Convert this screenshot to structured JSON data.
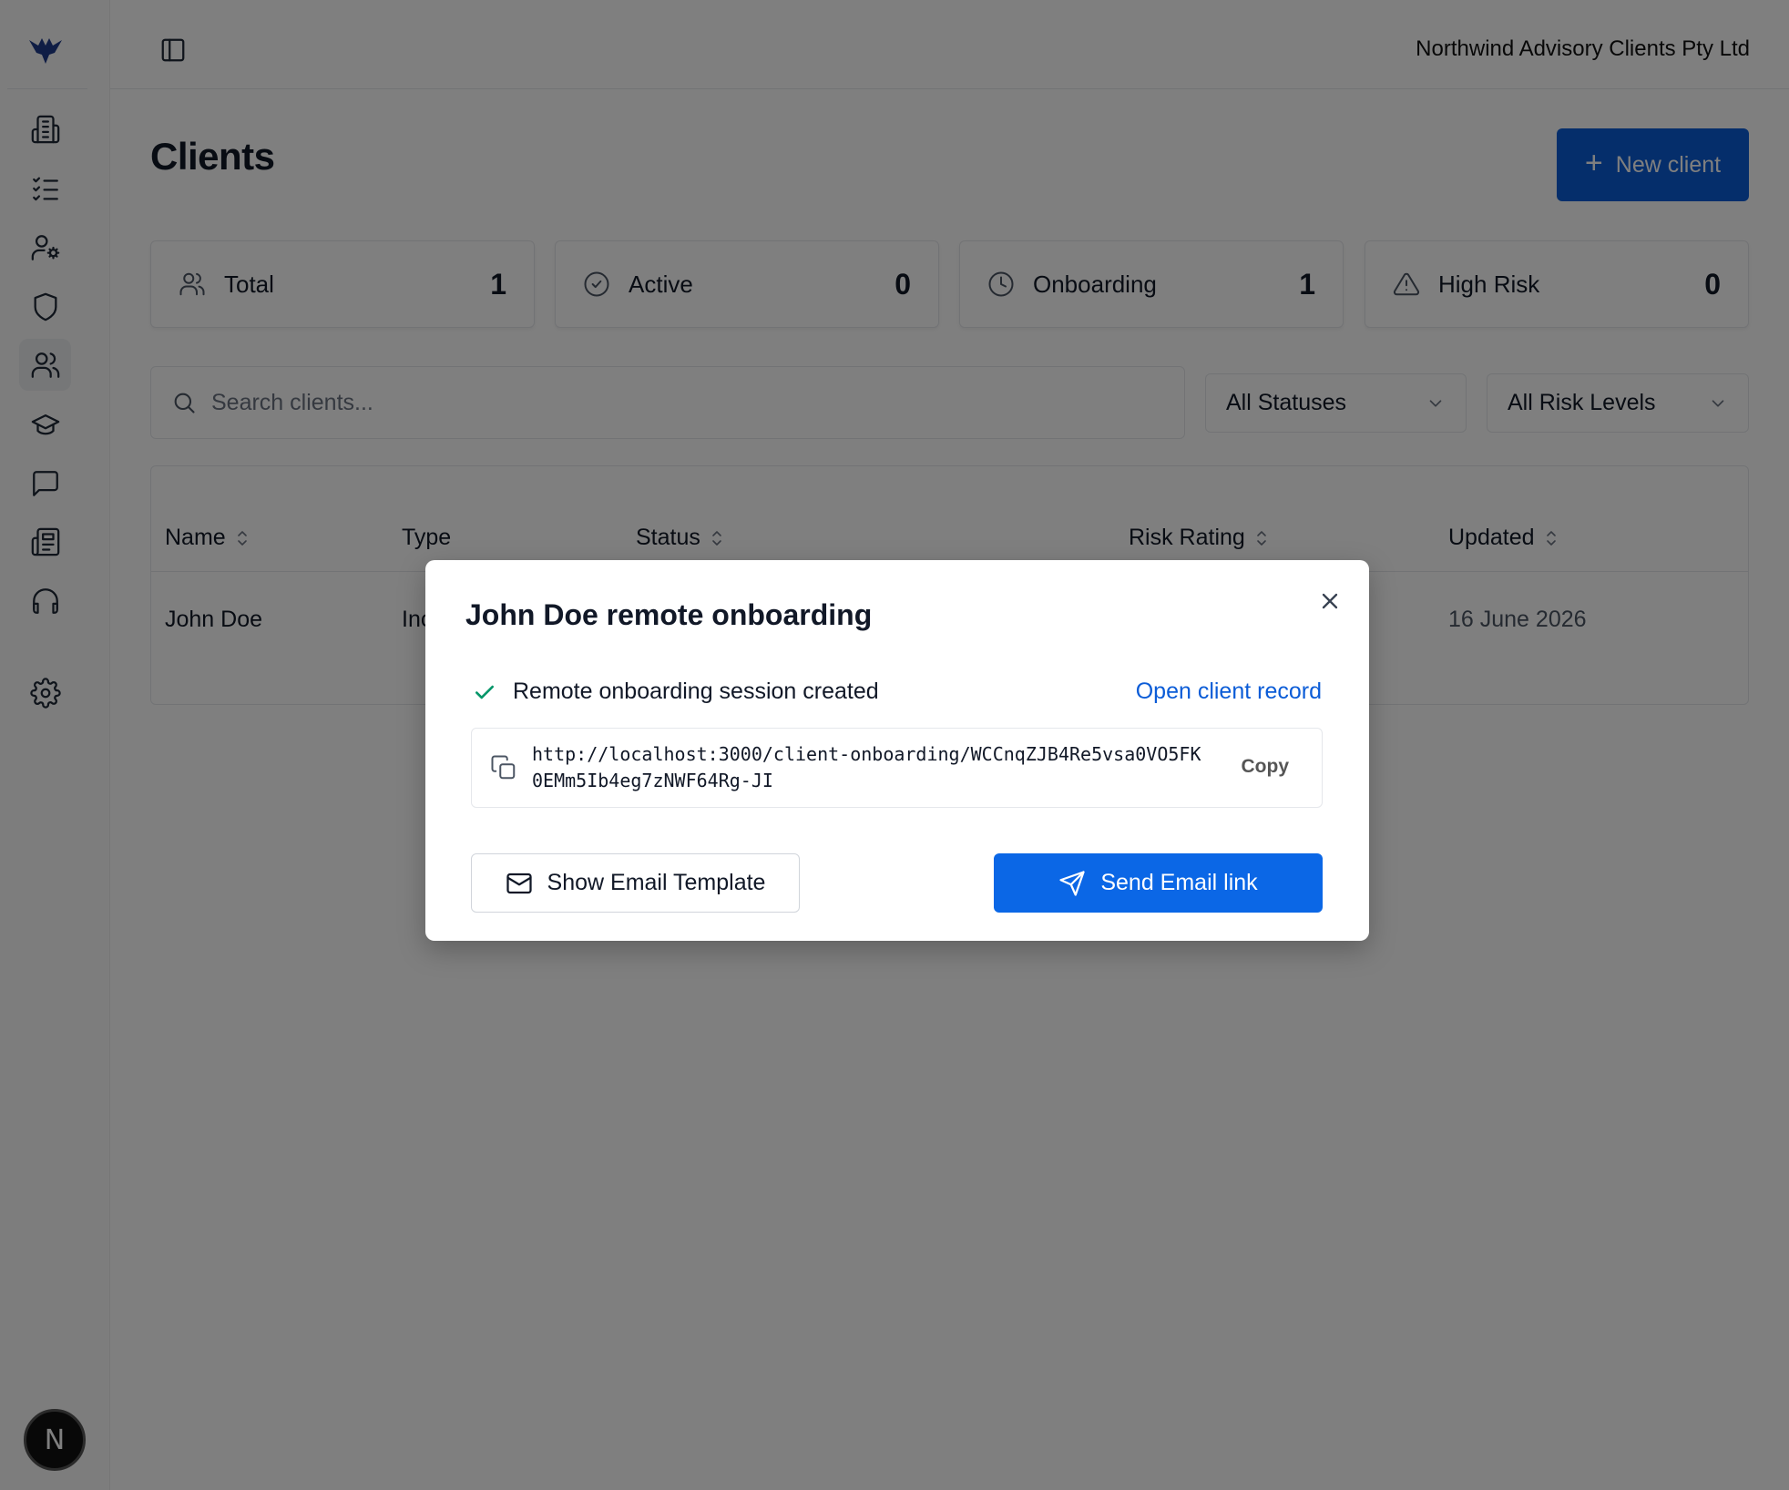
{
  "app": {
    "org_name": "Northwind Advisory Clients Pty Ltd",
    "avatar_initial": "N"
  },
  "sidebar": {
    "items": [
      {
        "name": "building-icon"
      },
      {
        "name": "checklist-icon"
      },
      {
        "name": "user-settings-icon"
      },
      {
        "name": "shield-icon"
      },
      {
        "name": "users-icon",
        "active": true
      },
      {
        "name": "graduation-cap-icon"
      },
      {
        "name": "message-icon"
      },
      {
        "name": "newspaper-icon"
      },
      {
        "name": "headphones-icon"
      },
      {
        "name": "gear-icon"
      }
    ]
  },
  "page": {
    "title": "Clients",
    "new_client_label": "New client"
  },
  "stats": [
    {
      "label": "Total",
      "value": "1",
      "icon": "users-icon"
    },
    {
      "label": "Active",
      "value": "0",
      "icon": "check-circle-icon"
    },
    {
      "label": "Onboarding",
      "value": "1",
      "icon": "clock-icon"
    },
    {
      "label": "High Risk",
      "value": "0",
      "icon": "alert-triangle-icon"
    }
  ],
  "filters": {
    "search_placeholder": "Search clients...",
    "status_value": "All Statuses",
    "risk_value": "All Risk Levels"
  },
  "table": {
    "columns": [
      "Name",
      "Type",
      "Status",
      "Risk Rating",
      "Updated"
    ],
    "rows": [
      {
        "name": "John Doe",
        "type": "Inc",
        "updated": "16 June 2026"
      }
    ]
  },
  "modal": {
    "title": "John Doe remote onboarding",
    "success_text": "Remote onboarding session created",
    "open_record_label": "Open client record",
    "url": "http://localhost:3000/client-onboarding/WCCnqZJB4Re5vsa0VO5FK0EMm5Ib4eg7zNWF64Rg-JI",
    "copy_label": "Copy",
    "show_template_label": "Show Email Template",
    "send_label": "Send Email link"
  },
  "colors": {
    "primary": "#0b67e6",
    "link": "#0b5cd7",
    "success": "#059669"
  }
}
